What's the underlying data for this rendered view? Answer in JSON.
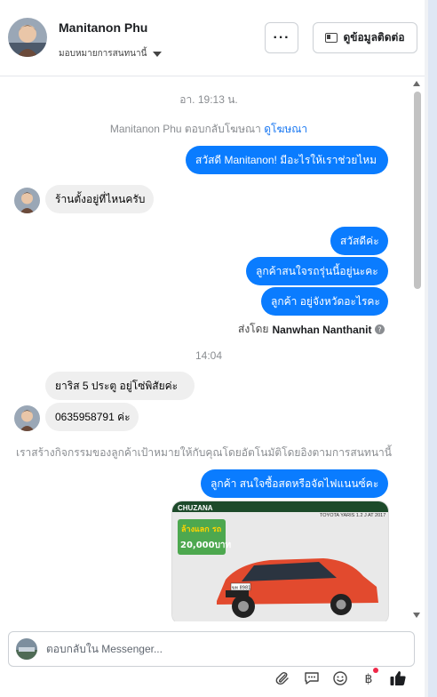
{
  "header": {
    "contact_name": "Manitanon Phu",
    "assign_label": "มอบหมายการสนทนานี้",
    "more_label": "···",
    "contact_info_label": "ดูข้อมูลติดต่อ"
  },
  "thread": {
    "timestamp_1": "อา. 19:13 น.",
    "ad_reply_prefix": "Manitanon Phu ตอบกลับโฆษณา",
    "ad_reply_link": "ดูโฆษณา",
    "msg_greeting": "สวัสดี Manitanon! มีอะไรให้เราช่วยไหม",
    "msg_in_1": "ร้านตั้งอยู่ที่ไหนครับ",
    "msg_out_1": "สวัสดีค่ะ",
    "msg_out_2": "ลูกค้าสนใจรถรุ่นนี้อยู่นะคะ",
    "msg_out_3": "ลูกค้า อยู่จังหวัดอะไรคะ",
    "sent_by_prefix": "ส่งโดย",
    "sent_by_name": "Nanwhan Nanthanit",
    "timestamp_2": "14:04",
    "msg_in_2": "ยาริส 5 ประตู    อยู่โซ่พิสัยค่ะ",
    "msg_in_3": "0635958791 ค่ะ",
    "system_note": "เราสร้างกิจกรรมของลูกค้าเป้าหมายให้กับคุณโดยอัตโนมัติโดยอิงตามการสนทนานี้",
    "msg_out_4": "ลูกค้า สนใจซื้อสดหรือจัดไฟแนนซ์คะ",
    "attachment": {
      "promo_text": "ล้างแลก รถ",
      "promo_price": "20,000บาท",
      "banner_text": "CHUZANA",
      "model_text": "TOYOTA YARIS 1.2 J AT 2017",
      "plate_text": "ฆท 8981"
    }
  },
  "composer": {
    "placeholder": "ตอบกลับใน Messenger..."
  },
  "colors": {
    "outgoing_bubble": "#0a7cff",
    "incoming_bubble": "#efefef",
    "link": "#1877f2",
    "badge": "#f02849"
  }
}
